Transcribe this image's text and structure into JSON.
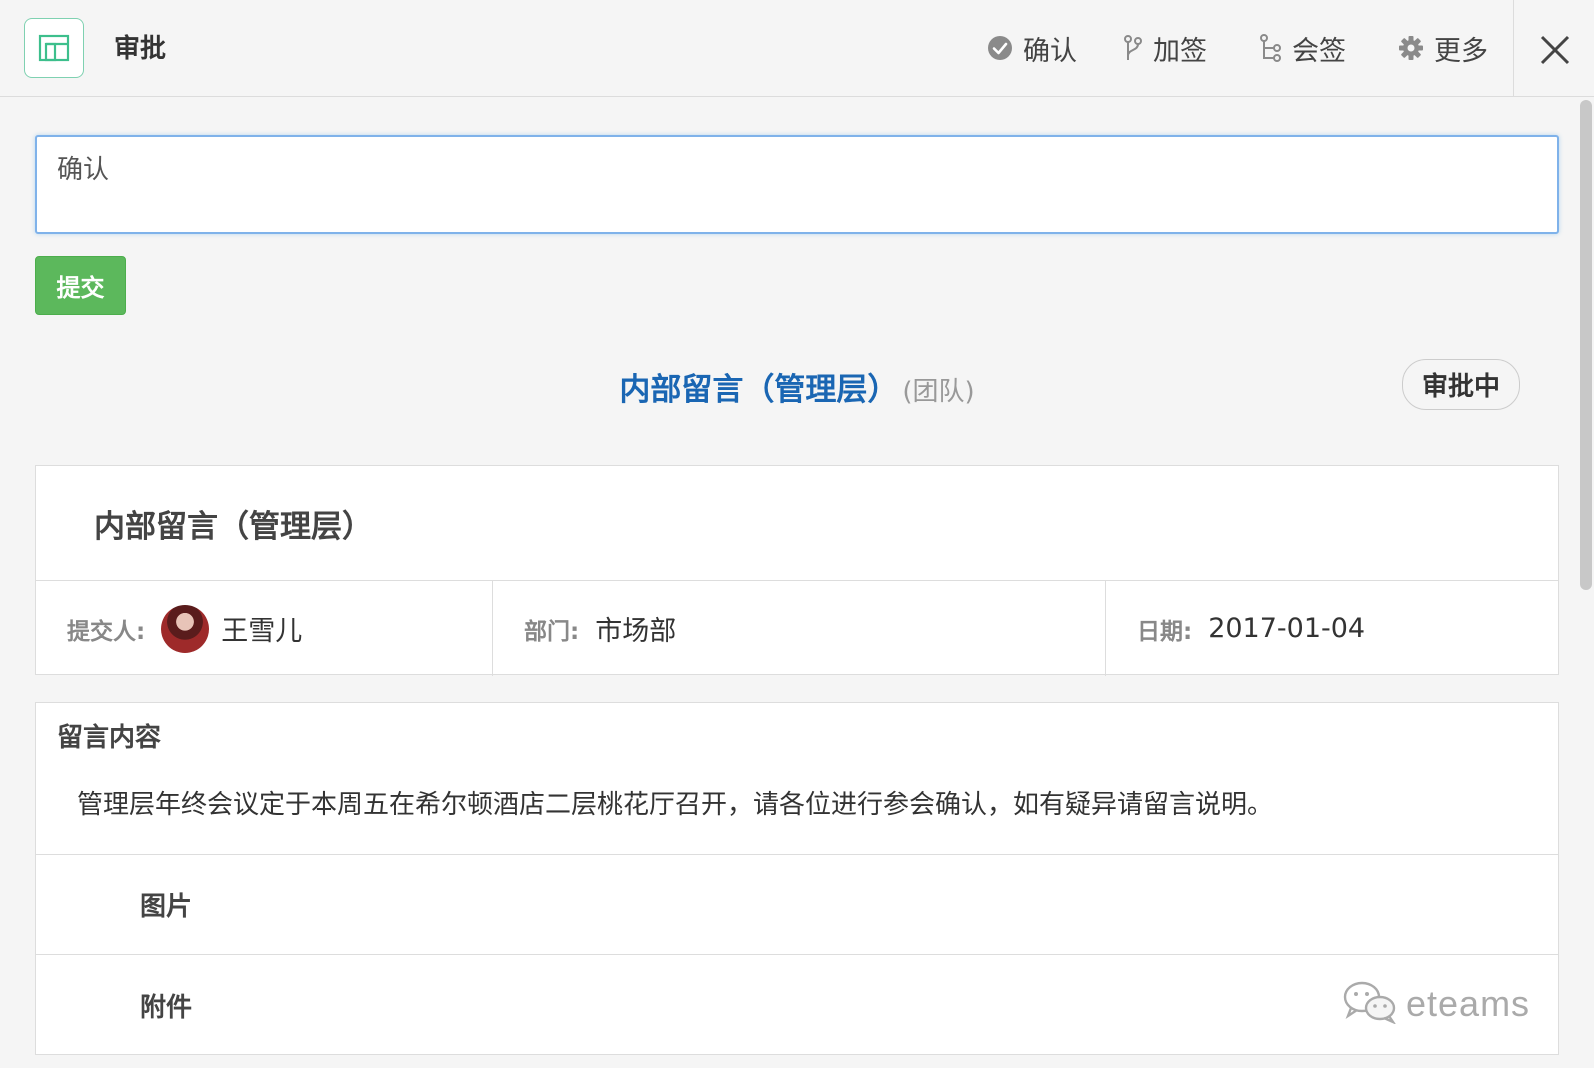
{
  "header": {
    "app_icon": "layout-icon",
    "title": "审批",
    "actions": [
      {
        "label": "确认",
        "icon": "check-circle-icon"
      },
      {
        "label": "加签",
        "icon": "branch-icon"
      },
      {
        "label": "会签",
        "icon": "flow-icon"
      },
      {
        "label": "更多",
        "icon": "gear-icon"
      }
    ],
    "close_icon": "close-icon"
  },
  "comment": {
    "value": "确认",
    "submit_label": "提交"
  },
  "form": {
    "title": "内部留言（管理层）",
    "scope": "(团队)",
    "status": "审批中",
    "panel_title": "内部留言（管理层）",
    "submitter_label": "提交人:",
    "submitter": "王雪儿",
    "department_label": "部门:",
    "department": "市场部",
    "date_label": "日期:",
    "date": "2017-01-04"
  },
  "content": {
    "heading": "留言内容",
    "text": "管理层年终会议定于本周五在希尔顿酒店二层桃花厅召开，请各位进行参会确认，如有疑异请留言说明。",
    "images_label": "图片",
    "attachments_label": "附件"
  },
  "watermark": {
    "text": "eteams",
    "icon": "wechat-icon"
  },
  "colors": {
    "accent_blue": "#1a66b3",
    "submit_green": "#5cb85c",
    "app_icon_green": "#3dbf8c",
    "focus_border": "#7fb2ea"
  }
}
